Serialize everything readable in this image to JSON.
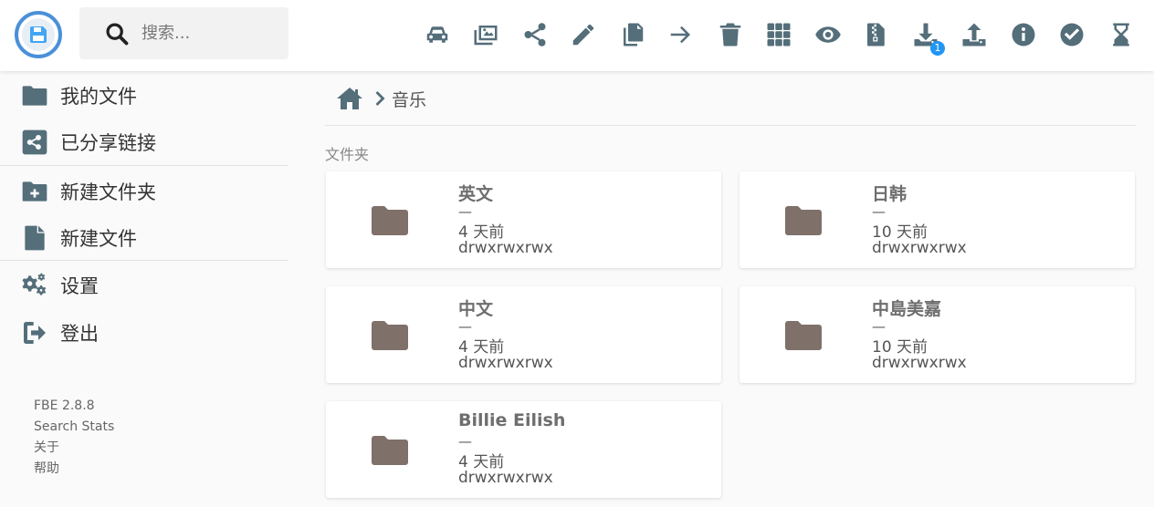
{
  "header": {
    "search_placeholder": "搜索...",
    "toolbar": [
      {
        "name": "car-icon",
        "title": ""
      },
      {
        "name": "gallery-icon",
        "title": ""
      },
      {
        "name": "share-icon",
        "title": ""
      },
      {
        "name": "pencil-icon",
        "title": ""
      },
      {
        "name": "copy-icon",
        "title": ""
      },
      {
        "name": "arrow-right-icon",
        "title": ""
      },
      {
        "name": "trash-icon",
        "title": ""
      },
      {
        "name": "grid-icon",
        "title": ""
      },
      {
        "name": "eye-icon",
        "title": ""
      },
      {
        "name": "zip-file-icon",
        "title": ""
      },
      {
        "name": "download-icon",
        "title": "",
        "badge": "1"
      },
      {
        "name": "upload-icon",
        "title": ""
      },
      {
        "name": "info-icon",
        "title": ""
      },
      {
        "name": "check-circle-icon",
        "title": ""
      },
      {
        "name": "hourglass-icon",
        "title": ""
      }
    ],
    "badge_color": "#2196f3"
  },
  "sidebar": {
    "items": [
      {
        "label": "我的文件",
        "icon": "folder-icon"
      },
      {
        "label": "已分享链接",
        "icon": "share-square-icon"
      },
      {
        "label": "新建文件夹",
        "icon": "folder-plus-icon"
      },
      {
        "label": "新建文件",
        "icon": "file-icon"
      },
      {
        "label": "设置",
        "icon": "cogs-icon"
      },
      {
        "label": "登出",
        "icon": "sign-out-icon"
      }
    ],
    "footer": {
      "version": "FBE 2.8.8",
      "search_stats": "Search Stats",
      "about": "关于",
      "help": "帮助"
    }
  },
  "breadcrumb": {
    "current": "音乐"
  },
  "listing": {
    "section_title": "文件夹",
    "folders": [
      {
        "name": "英文",
        "size": "—",
        "modified": "4 天前",
        "permissions": "drwxrwxrwx"
      },
      {
        "name": "日韩",
        "size": "—",
        "modified": "10 天前",
        "permissions": "drwxrwxrwx"
      },
      {
        "name": "中文",
        "size": "—",
        "modified": "4 天前",
        "permissions": "drwxrwxrwx"
      },
      {
        "name": "中島美嘉",
        "size": "—",
        "modified": "10 天前",
        "permissions": "drwxrwxrwx"
      },
      {
        "name": "Billie Eilish",
        "size": "—",
        "modified": "4 天前",
        "permissions": "drwxrwxrwx"
      }
    ],
    "folder_color": "#7f7069"
  },
  "colors": {
    "icon": "#546e7a",
    "logo_ring": "#4a90d9"
  }
}
